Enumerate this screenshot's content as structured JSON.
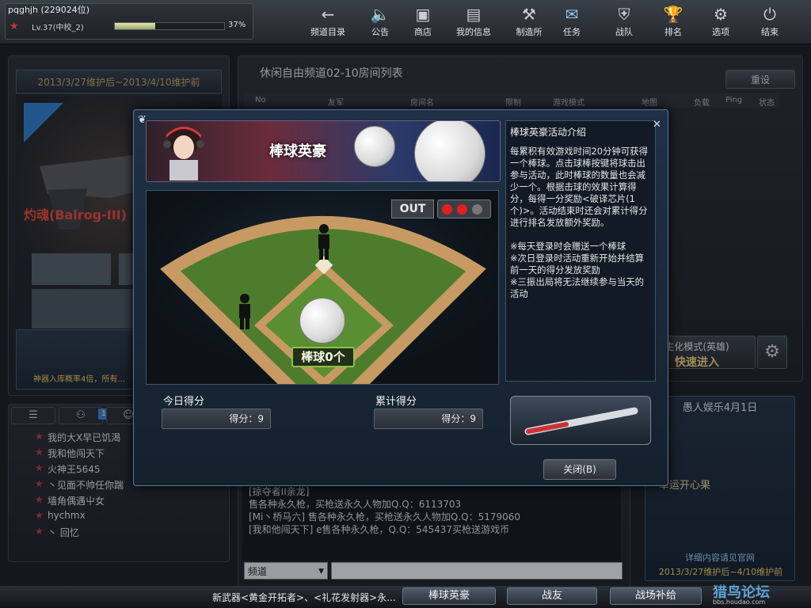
{
  "user": {
    "name": "pqghjh (229024位)",
    "level": "Lv.37(中校_2)",
    "xp_percent": 37,
    "xp_text": "37%"
  },
  "nav": [
    {
      "label": "频道目录",
      "icon": "back-arrow-icon"
    },
    {
      "label": "公告",
      "icon": "speaker-icon"
    },
    {
      "label": "商店",
      "icon": "shop-icon"
    },
    {
      "label": "我的信息",
      "icon": "profile-card-icon"
    },
    {
      "label": "制造所",
      "icon": "factory-icon"
    },
    {
      "label": "任务",
      "icon": "mission-icon"
    },
    {
      "label": "战队",
      "icon": "clan-shield-icon"
    },
    {
      "label": "排名",
      "icon": "trophy-icon"
    },
    {
      "label": "选项",
      "icon": "gear-icon"
    },
    {
      "label": "结束",
      "icon": "power-icon"
    }
  ],
  "promo": {
    "date": "2013/3/27维护后~2013/4/10维护前",
    "weapon": "灼魂(Balrog-III)",
    "note": "神器入库概率4倍，所有..."
  },
  "room": {
    "title": "休闲自由频道02-10房间列表",
    "refresh": "重设",
    "headers": [
      "No",
      "友军",
      "房间名",
      "限制",
      "游戏模式",
      "地图",
      "负载",
      "Ping",
      "状态"
    ]
  },
  "quickstart": {
    "mode": "生化模式(英雄)",
    "label": "快速进入"
  },
  "chat": {
    "lines": [
      "[掠夺者II亲龙]",
      "售各种永久枪，买枪送永久人物加Q.Q：6113703",
      "[Mi丶桥马六] 售各种永久枪，买枪送永久人物加Q.Q：5179060",
      "[我和他闯天下] e售各种永久枪，Q.Q：545437买枪送游戏币"
    ],
    "channel": "频道",
    "input": ""
  },
  "friends": [
    "我的大X早已饥渴",
    "我和他闯天下",
    "火神王5645",
    "丶见面不帅任你踹",
    "墙角偶遇屮女",
    "hychmx",
    "丶 回忆"
  ],
  "friend_tabs": {
    "badge": "1"
  },
  "dialog": {
    "title": "棒球英豪",
    "out": "OUT",
    "ball_count": "棒球0个",
    "today_label": "今日得分",
    "today_score": "得分：9",
    "total_label": "累计得分",
    "total_score": "得分：9",
    "info_title": "棒球英豪活动介绍",
    "info_body": "每累积有效游戏时间20分钟可获得一个棒球。点击球棒按键将球击出参与活动，此时棒球的数量也会减少一个。根据击球的效果计算得分，每得一分奖励<破译芯片(1个)>。活动结束时还会对累计得分进行排名发放额外奖励。\n\n※每天登录时会赠送一个棒球\n※次日登录时活动重新开始并结算前一天的得分发放奖励\n※三振出局将无法继续参与当天的活动",
    "close": "关闭(B)"
  },
  "right_ad": {
    "title": "愚人娱乐4月1日",
    "lucky": "幸运开心果",
    "link": "详细内容请见官网",
    "date": "2013/3/27维护后~4/10维护前"
  },
  "bottom": {
    "ticker": "新武器<黄金开拓者>、<礼花发射器>永...",
    "buttons": [
      "棒球英豪",
      "战友",
      "战场补给"
    ]
  },
  "watermark": {
    "main": "猎鸟论坛",
    "sub": "bbs.houdao.com"
  },
  "colors": {
    "accent": "#8ec24a",
    "dialog_border": "#5b7896",
    "promo_red": "#e84b3c"
  }
}
